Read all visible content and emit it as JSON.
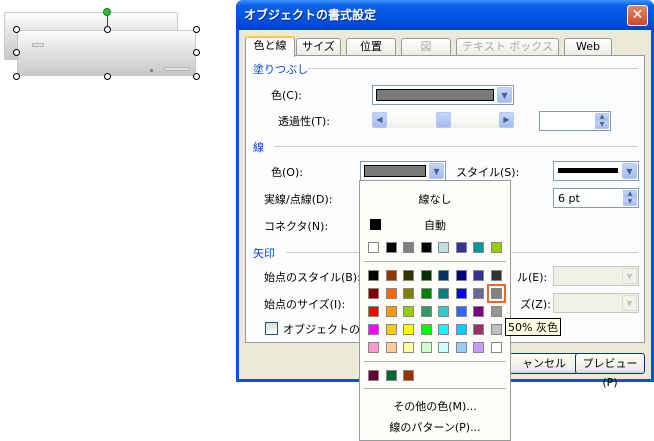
{
  "dialog": {
    "title": "オブジェクトの書式設定",
    "close_glyph": "✕",
    "tabs": [
      "色と線",
      "サイズ",
      "位置",
      "図",
      "テキスト ボックス",
      "Web"
    ],
    "fill": {
      "section": "塗りつぶし",
      "color_label": "色(C):",
      "transparency_label": "透過性(T):",
      "fill_color": "#7a7a7a"
    },
    "line": {
      "section": "線",
      "color_label": "色(O):",
      "style_label": "スタイル(S):",
      "dash_label": "実線/点線(D):",
      "weight_value": "6 pt",
      "connector_label": "コネクタ(N):",
      "line_color": "#7a7a7a"
    },
    "arrows": {
      "section": "矢印",
      "begin_style_label": "始点のスタイル(B):",
      "end_style_label": "ル(E):",
      "begin_size_label": "始点のサイズ(I):",
      "end_size_label": "ズ(Z):"
    },
    "default_checkbox_label": "オブジェクトの既定",
    "buttons": {
      "cancel": "ャンセル",
      "preview": "プレビュー(P)"
    }
  },
  "palette": {
    "no_line": "線なし",
    "automatic": "自動",
    "more_colors": "その他の色(M)...",
    "line_pattern": "線のパターン(P)...",
    "tooltip": "50% 灰色",
    "scheme_colors": [
      "#ffffff",
      "#000000",
      "#808080",
      "#000000",
      "#c0e0e0",
      "#333399",
      "#009999",
      "#99cc00"
    ],
    "standard_colors": [
      [
        "#000000",
        "#993300",
        "#333300",
        "#003300",
        "#003366",
        "#000080",
        "#333399",
        "#333333"
      ],
      [
        "#800000",
        "#ff6600",
        "#808000",
        "#008000",
        "#008080",
        "#0000ff",
        "#666699",
        "#808080"
      ],
      [
        "#ff0000",
        "#ff9900",
        "#99cc00",
        "#339966",
        "#33cccc",
        "#3366ff",
        "#800080",
        "#969696"
      ],
      [
        "#ff00ff",
        "#ffcc00",
        "#ffff00",
        "#00ff00",
        "#00ffff",
        "#00ccff",
        "#993366",
        "#c0c0c0"
      ],
      [
        "#ff99cc",
        "#ffcc99",
        "#ffff99",
        "#ccffcc",
        "#ccffff",
        "#99ccff",
        "#cc99ff",
        "#ffffff"
      ]
    ],
    "recent_colors": [
      "#660033",
      "#006633",
      "#993300"
    ],
    "selected_color": "#808080"
  }
}
